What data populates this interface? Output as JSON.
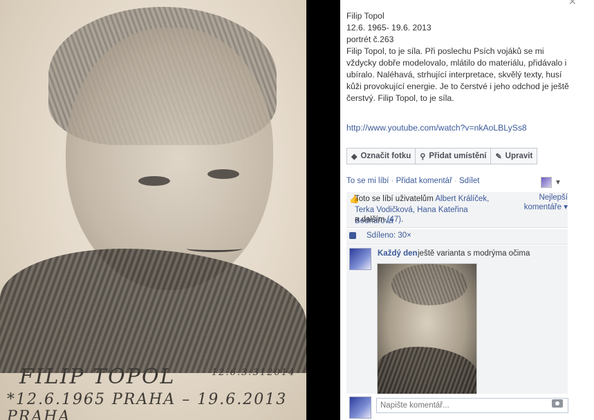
{
  "photo": {
    "caption_name": "FILIP TOPOL",
    "caption_dates": "*12.6.1965 PRAHA – 19.6.2013 PRAHA",
    "caption_signature": "12.6.3:312014"
  },
  "post": {
    "title": "Filip Topol",
    "dates": "12.6. 1965- 19.6. 2013",
    "portrait": "portrét č.263",
    "body": "Filip Topol, to je síla. Při poslechu Psích vojáků se mi vždycky dobře modelovalo, mlátilo do materiálu, přidávalo i ubíralo. Naléhavá, strhující interpretace, skvělý texty, husí kůži provokující energie. Je to čerstvé i jeho odchod je ještě čerstvý. Filip Topol, to je síla.",
    "link": "http://www.youtube.com/watch?v=nkAoLBLySs8"
  },
  "actions": {
    "tag": "Označit fotku",
    "location": "Přidat umístění",
    "edit": "Upravit"
  },
  "like_row": {
    "like": "To se mi líbí",
    "sep1": " · ",
    "comment": "Přidat komentář",
    "sep2": " · ",
    "share": "Sdílet"
  },
  "likes": {
    "prefix": "Toto se líbí uživatelům ",
    "names": "Albert Králíček, Terka Vodičková, Hana Kateřina Bednářová",
    "and_more": "a dalším ",
    "count": "(47)",
    "end": ".",
    "best": "Nejlepší komentáře ▾"
  },
  "shared": "Sdíleno: 30×",
  "comment": {
    "author": "Každý den",
    "text": "ještě varianta s modrýma očima"
  },
  "input": {
    "placeholder": "Napište komentář..."
  },
  "icons": {
    "close": "close-icon",
    "tag": "tag-icon",
    "location": "map-pin-icon",
    "edit": "pencil-icon",
    "like": "thumbs-up-icon",
    "share": "share-icon",
    "camera": "camera-icon"
  },
  "colors": {
    "link": "#3b5998",
    "panel_bg": "#ffffff",
    "box_bg": "#f2f3f5"
  }
}
